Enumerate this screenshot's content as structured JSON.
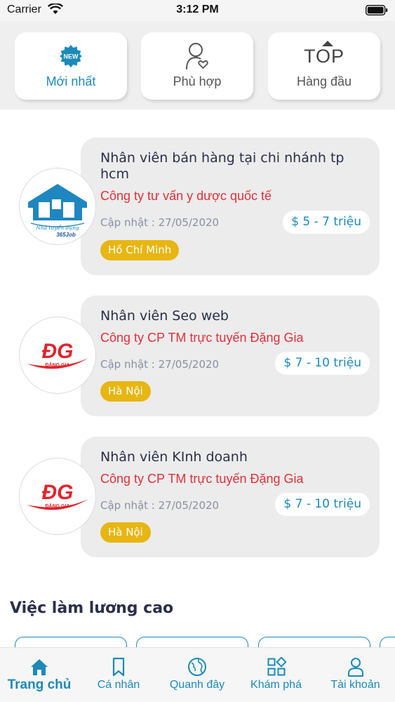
{
  "status_bar": {
    "carrier": "Carrier",
    "time": "3:12 PM"
  },
  "filters": [
    {
      "label": "Mới nhất",
      "icon": "new-badge-icon",
      "badge_text": "NEW",
      "active": true
    },
    {
      "label": "Phù hợp",
      "icon": "person-heart-icon",
      "active": false
    },
    {
      "label": "Hàng đầu",
      "icon": "top-icon",
      "icon_text": "TOP",
      "active": false
    }
  ],
  "jobs": [
    {
      "title": "Nhân viên bán hàng tại chi nhánh tp hcm",
      "company": "Công ty tư vấn y dược quốc tế",
      "update": "Cập nhật : 27/05/2020",
      "salary": "$ 5 - 7 triệu",
      "location": "Hồ Chí Minh",
      "logo": {
        "type": "house",
        "line1": "Nhà tuyển dụng",
        "line2": "365Job"
      }
    },
    {
      "title": "Nhân viên Seo web",
      "company": "Công ty CP TM trực tuyến Đặng Gia",
      "update": "Cập nhật : 27/05/2020",
      "salary": "$ 7 - 10 triệu",
      "location": "Hà Nội",
      "logo": {
        "type": "dg",
        "mark": "ĐG",
        "sub": "ĐẶNG GIA"
      }
    },
    {
      "title": "Nhân viên KInh doanh",
      "company": "Công ty CP TM trực tuyến Đặng Gia",
      "update": "Cập nhật : 27/05/2020",
      "salary": "$ 7 - 10 triệu",
      "location": "Hà Nội",
      "logo": {
        "type": "dg",
        "mark": "ĐG",
        "sub": "ĐẶNG GIA"
      }
    }
  ],
  "section": {
    "title": "Việc làm lương cao"
  },
  "tabs": [
    {
      "label": "Trang chủ",
      "icon": "home-icon",
      "active": true
    },
    {
      "label": "Cá nhân",
      "icon": "bookmark-icon",
      "active": false
    },
    {
      "label": "Quanh đây",
      "icon": "globe-icon",
      "active": false
    },
    {
      "label": "Khám phá",
      "icon": "grid-icon",
      "active": false
    },
    {
      "label": "Tài khoản",
      "icon": "user-icon",
      "active": false
    }
  ],
  "colors": {
    "accent": "#1c8ab9",
    "company": "#e0303a",
    "location_badge": "#e8b612",
    "card_bg": "#ececec"
  }
}
